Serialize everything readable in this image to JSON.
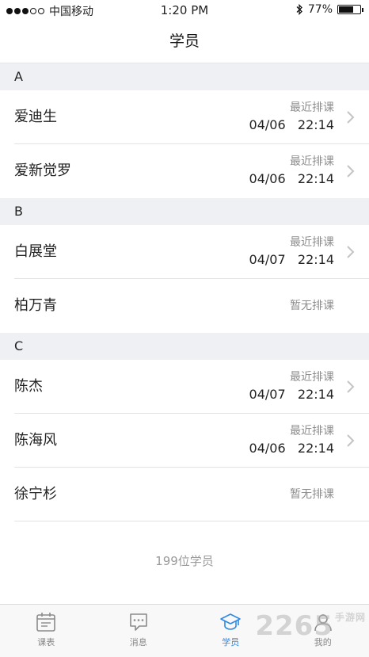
{
  "status_bar": {
    "carrier": "中国移动",
    "time": "1:20 PM",
    "battery": "77%",
    "battery_level": 0.77
  },
  "nav": {
    "title": "学员"
  },
  "sections": [
    {
      "letter": "A",
      "students": [
        {
          "name": "爱迪生",
          "label": "最近排课",
          "date": "04/06",
          "time": "22:14"
        },
        {
          "name": "爱新觉罗",
          "label": "最近排课",
          "date": "04/06",
          "time": "22:14"
        }
      ]
    },
    {
      "letter": "B",
      "students": [
        {
          "name": "白展堂",
          "label": "最近排课",
          "date": "04/07",
          "time": "22:14"
        },
        {
          "name": "柏万青",
          "none": "暂无排课"
        }
      ]
    },
    {
      "letter": "C",
      "students": [
        {
          "name": "陈杰",
          "label": "最近排课",
          "date": "04/07",
          "time": "22:14"
        },
        {
          "name": "陈海风",
          "label": "最近排课",
          "date": "04/06",
          "time": "22:14"
        },
        {
          "name": "徐宁杉",
          "none": "暂无排课"
        }
      ]
    }
  ],
  "footer": {
    "count": "199位学员"
  },
  "tabs": [
    {
      "label": "课表",
      "icon": "calendar-icon",
      "active": false
    },
    {
      "label": "消息",
      "icon": "chat-bubble-icon",
      "active": false
    },
    {
      "label": "学员",
      "icon": "graduation-cap-icon",
      "active": true
    },
    {
      "label": "我的",
      "icon": "person-icon",
      "active": false
    }
  ],
  "watermark": {
    "text": "2265",
    "sub": "手游网"
  },
  "colors": {
    "accent": "#2e8ae6",
    "section_bg": "#eef0f3",
    "muted": "#8e8e8e"
  }
}
